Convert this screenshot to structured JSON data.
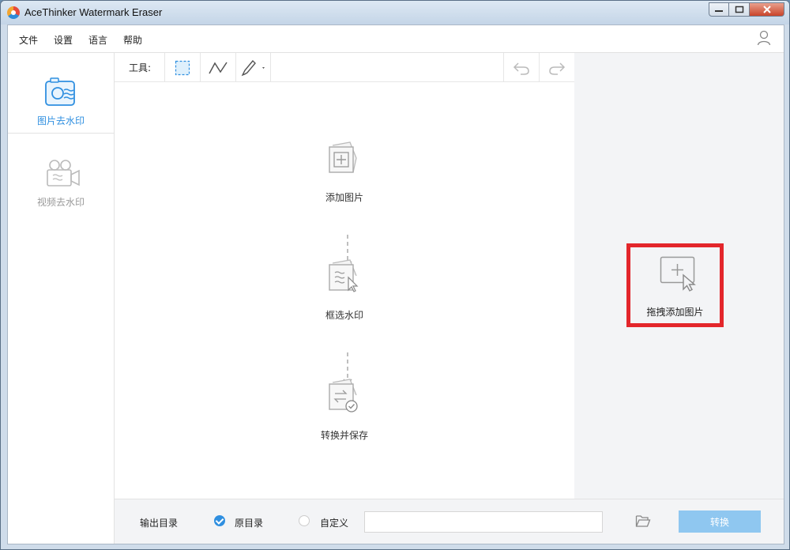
{
  "window": {
    "title": "AceThinker Watermark Eraser",
    "controls": {
      "minimize": "▭",
      "maximize": "▢",
      "close": "✕"
    }
  },
  "menu": {
    "items": [
      "文件",
      "设置",
      "语言",
      "帮助"
    ],
    "user_icon": "user-icon"
  },
  "sidebar": {
    "items": [
      {
        "label": "图片去水印",
        "icon": "photo-camera-icon",
        "active": true
      },
      {
        "label": "视频去水印",
        "icon": "video-camera-icon",
        "active": false
      }
    ]
  },
  "toolbar": {
    "label": "工具:",
    "tools": [
      "rectangle-select-icon",
      "polyline-select-icon",
      "brush-icon"
    ],
    "undo_icon": "undo-icon",
    "redo_icon": "redo-icon"
  },
  "steps": [
    {
      "label": "添加图片",
      "icon": "add-image-icon"
    },
    {
      "label": "框选水印",
      "icon": "select-watermark-icon"
    },
    {
      "label": "转换并保存",
      "icon": "convert-save-icon"
    }
  ],
  "drop_zone": {
    "label": "拖拽添加图片",
    "icon": "add-image-cursor-icon",
    "highlight_color": "#e3262b"
  },
  "bottom": {
    "output_label": "输出目录",
    "option_original": "原目录",
    "option_custom": "自定义",
    "selected": "原目录",
    "path_value": "",
    "folder_icon": "folder-icon",
    "convert_label": "转换"
  },
  "colors": {
    "accent": "#2f8fe0",
    "convert_button": "#8fc7f0"
  }
}
